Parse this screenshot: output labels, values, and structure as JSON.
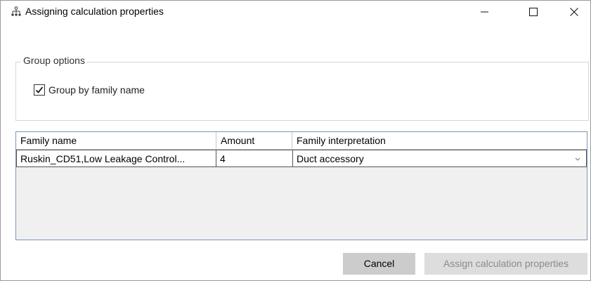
{
  "window": {
    "title": "Assigning calculation properties",
    "controls": {
      "minimize": "—",
      "close": "✕"
    }
  },
  "group_options": {
    "legend": "Group options",
    "group_by_family": {
      "label": "Group by family name",
      "checked": true
    }
  },
  "table": {
    "columns": [
      "Family name",
      "Amount",
      "Family interpretation"
    ],
    "rows": [
      {
        "family_name": "Ruskin_CD51,Low Leakage Control...",
        "amount": "4",
        "interpretation": "Duct accessory"
      }
    ]
  },
  "buttons": {
    "cancel": "Cancel",
    "assign": "Assign calculation properties"
  },
  "colors": {
    "grid_border": "#7a95b8",
    "button_bg": "#cccccc",
    "disabled_text": "#8a8a8a"
  }
}
